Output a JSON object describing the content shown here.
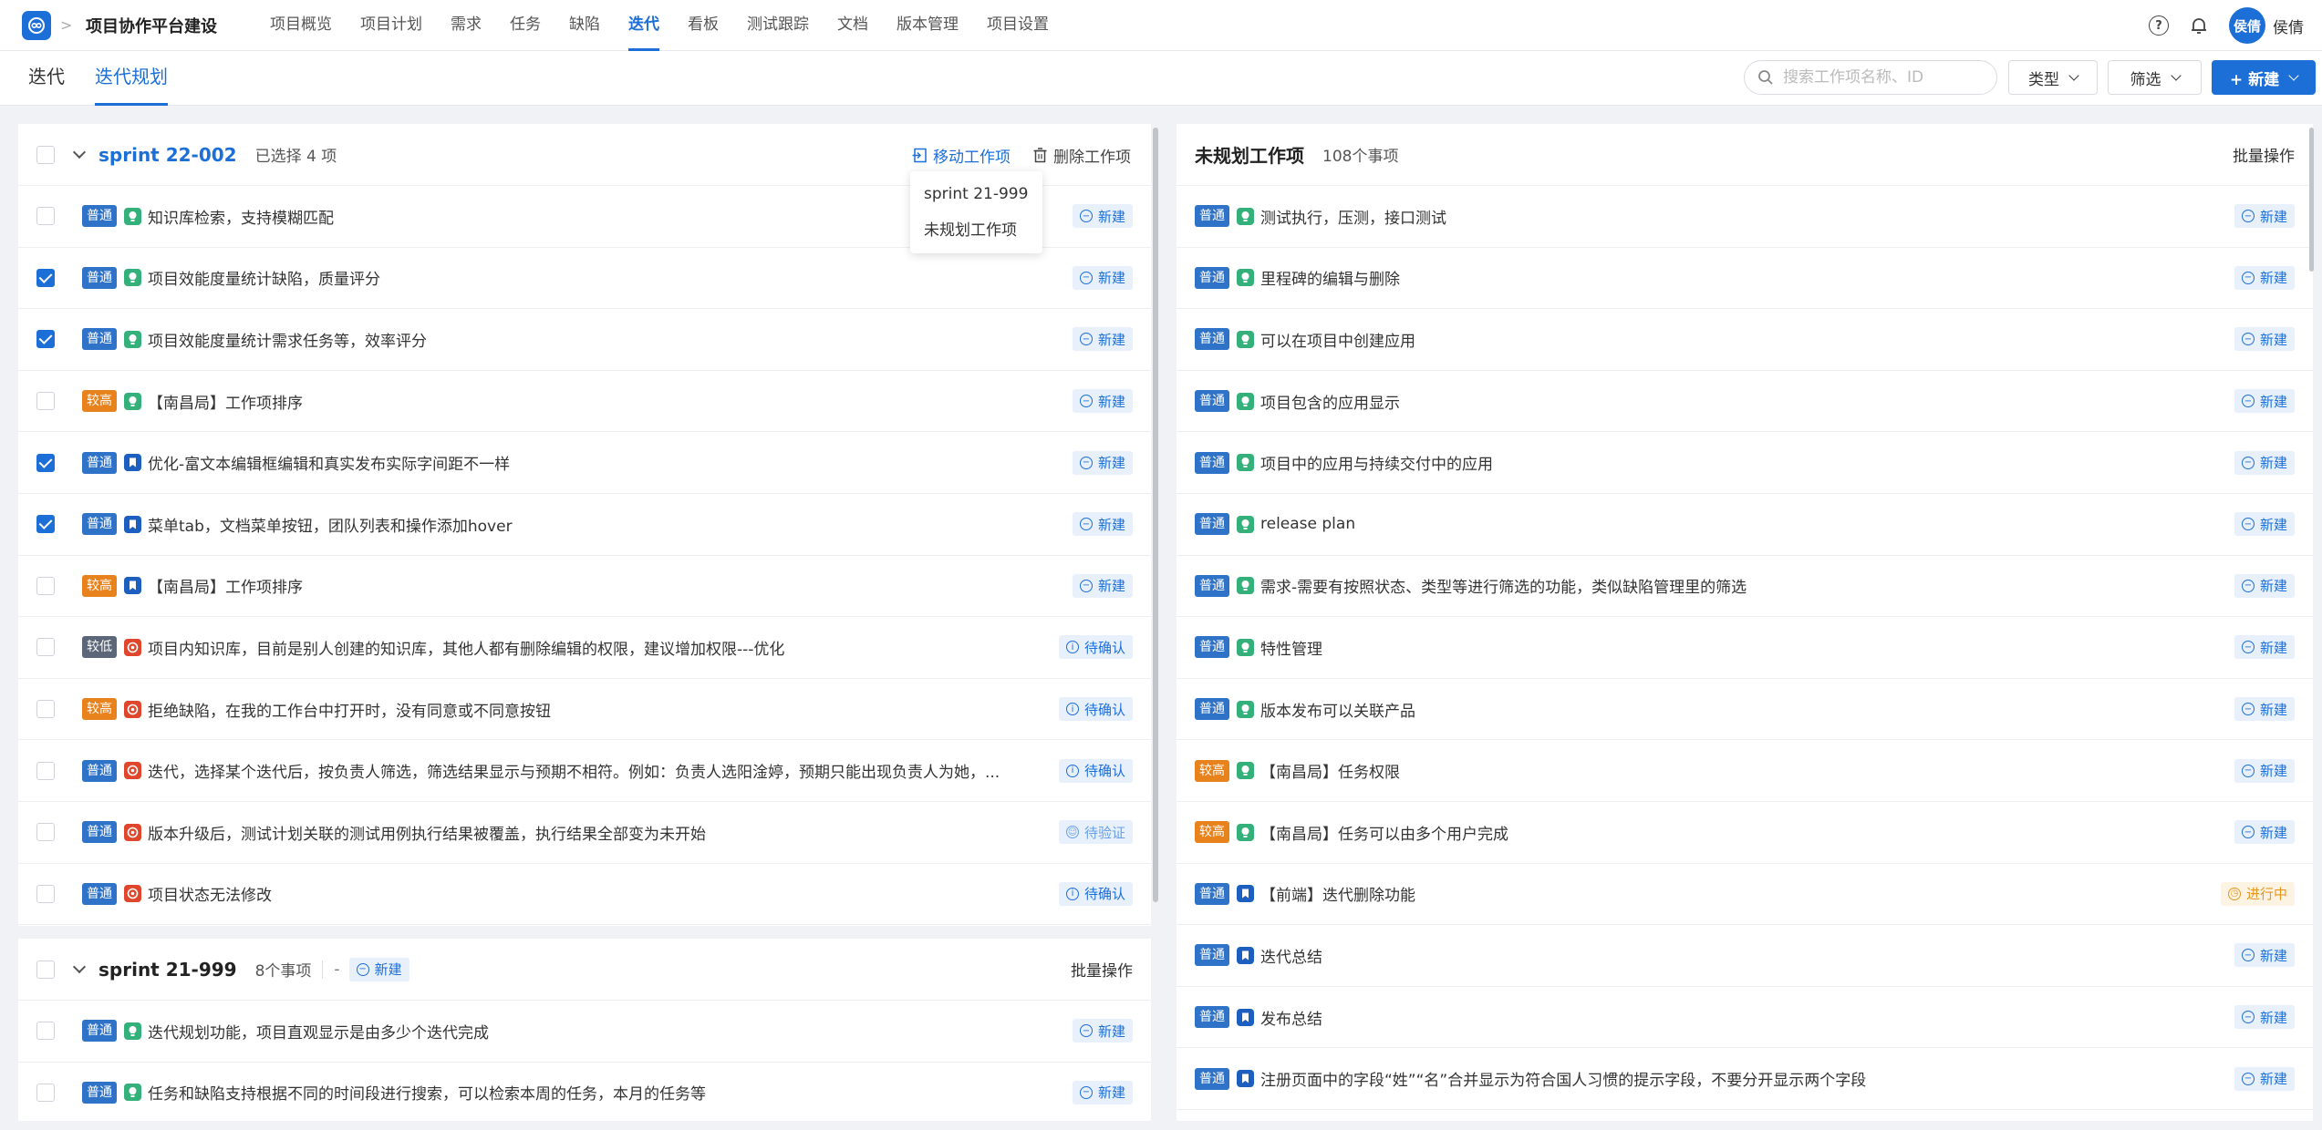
{
  "header": {
    "project_name": "项目协作平台建设",
    "nav": [
      "项目概览",
      "项目计划",
      "需求",
      "任务",
      "缺陷",
      "迭代",
      "看板",
      "测试跟踪",
      "文档",
      "版本管理",
      "项目设置"
    ],
    "active_nav": "迭代",
    "avatar_text": "侯倩",
    "user_name": "侯倩",
    "help_icon": "?"
  },
  "subbar": {
    "tabs": [
      "迭代",
      "迭代规划"
    ],
    "active_tab": "迭代规划",
    "search_placeholder": "搜索工作项名称、ID",
    "type_label": "类型",
    "filter_label": "筛选",
    "new_label": "+ 新建"
  },
  "colors": {
    "primary": "#1d6fd8",
    "prio_normal": "#2f73c9",
    "prio_high": "#e8821d",
    "prio_low": "#5b6778",
    "req_icon": "#34b07a",
    "task_icon": "#1d5fc0",
    "bug_icon": "#e0462c"
  },
  "sprint_a": {
    "title": "sprint 22-002",
    "selected": "已选择 4 项",
    "move_label": "移动工作项",
    "delete_label": "删除工作项",
    "menu": [
      "sprint 21-999",
      "未规划工作项"
    ],
    "rows": [
      {
        "checked": false,
        "prio": "普通",
        "ptype": "normal",
        "itype": "req",
        "title": "知识库检索，支持模糊匹配",
        "status": "新建",
        "stype": "new"
      },
      {
        "checked": true,
        "prio": "普通",
        "ptype": "normal",
        "itype": "req",
        "title": "项目效能度量统计缺陷，质量评分",
        "status": "新建",
        "stype": "new"
      },
      {
        "checked": true,
        "prio": "普通",
        "ptype": "normal",
        "itype": "req",
        "title": "项目效能度量统计需求任务等，效率评分",
        "status": "新建",
        "stype": "new"
      },
      {
        "checked": false,
        "prio": "较高",
        "ptype": "high",
        "itype": "req",
        "title": "【南昌局】工作项排序",
        "status": "新建",
        "stype": "new"
      },
      {
        "checked": true,
        "prio": "普通",
        "ptype": "normal",
        "itype": "task",
        "title": "优化-富文本编辑框编辑和真实发布实际字间距不一样",
        "status": "新建",
        "stype": "new"
      },
      {
        "checked": true,
        "prio": "普通",
        "ptype": "normal",
        "itype": "task",
        "title": "菜单tab，文档菜单按钮，团队列表和操作添加hover",
        "status": "新建",
        "stype": "new"
      },
      {
        "checked": false,
        "prio": "较高",
        "ptype": "high",
        "itype": "task",
        "title": "【南昌局】工作项排序",
        "status": "新建",
        "stype": "new"
      },
      {
        "checked": false,
        "prio": "较低",
        "ptype": "low",
        "itype": "bug",
        "title": "项目内知识库，目前是别人创建的知识库，其他人都有删除编辑的权限，建议增加权限---优化",
        "status": "待确认",
        "stype": "confirm"
      },
      {
        "checked": false,
        "prio": "较高",
        "ptype": "high",
        "itype": "bug",
        "title": "拒绝缺陷，在我的工作台中打开时，没有同意或不同意按钮",
        "status": "待确认",
        "stype": "confirm"
      },
      {
        "checked": false,
        "prio": "普通",
        "ptype": "normal",
        "itype": "bug",
        "title": "迭代，选择某个迭代后，按负责人筛选，筛选结果显示与预期不相符。例如：负责人选阳淦婷，预期只能出现负责人为她，...",
        "status": "待确认",
        "stype": "confirm"
      },
      {
        "checked": false,
        "prio": "普通",
        "ptype": "normal",
        "itype": "bug",
        "title": "版本升级后，测试计划关联的测试用例执行结果被覆盖，执行结果全部变为未开始",
        "status": "待验证",
        "stype": "verify"
      },
      {
        "checked": false,
        "prio": "普通",
        "ptype": "normal",
        "itype": "bug",
        "title": "项目状态无法修改",
        "status": "待确认",
        "stype": "confirm"
      }
    ]
  },
  "sprint_b": {
    "title": "sprint 21-999",
    "count": "8个事项",
    "dash": "-",
    "state": "新建",
    "batch": "批量操作",
    "rows": [
      {
        "checked": false,
        "prio": "普通",
        "ptype": "normal",
        "itype": "req",
        "title": "迭代规划功能，项目直观显示是由多少个迭代完成",
        "status": "新建",
        "stype": "new"
      },
      {
        "checked": false,
        "prio": "普通",
        "ptype": "normal",
        "itype": "req",
        "title": "任务和缺陷支持根据不同的时间段进行搜索，可以检索本周的任务，本月的任务等",
        "status": "新建",
        "stype": "new"
      }
    ]
  },
  "unplanned": {
    "title": "未规划工作项",
    "count": "108个事项",
    "batch": "批量操作",
    "rows": [
      {
        "prio": "普通",
        "ptype": "normal",
        "itype": "req",
        "title": "测试执行，压测，接口测试",
        "status": "新建",
        "stype": "new"
      },
      {
        "prio": "普通",
        "ptype": "normal",
        "itype": "req",
        "title": "里程碑的编辑与删除",
        "status": "新建",
        "stype": "new"
      },
      {
        "prio": "普通",
        "ptype": "normal",
        "itype": "req",
        "title": "可以在项目中创建应用",
        "status": "新建",
        "stype": "new"
      },
      {
        "prio": "普通",
        "ptype": "normal",
        "itype": "req",
        "title": "项目包含的应用显示",
        "status": "新建",
        "stype": "new"
      },
      {
        "prio": "普通",
        "ptype": "normal",
        "itype": "req",
        "title": "项目中的应用与持续交付中的应用",
        "status": "新建",
        "stype": "new"
      },
      {
        "prio": "普通",
        "ptype": "normal",
        "itype": "req",
        "title": "release plan",
        "status": "新建",
        "stype": "new"
      },
      {
        "prio": "普通",
        "ptype": "normal",
        "itype": "req",
        "title": "需求-需要有按照状态、类型等进行筛选的功能，类似缺陷管理里的筛选",
        "status": "新建",
        "stype": "new"
      },
      {
        "prio": "普通",
        "ptype": "normal",
        "itype": "req",
        "title": "特性管理",
        "status": "新建",
        "stype": "new"
      },
      {
        "prio": "普通",
        "ptype": "normal",
        "itype": "req",
        "title": "版本发布可以关联产品",
        "status": "新建",
        "stype": "new"
      },
      {
        "prio": "较高",
        "ptype": "high",
        "itype": "req",
        "title": "【南昌局】任务权限",
        "status": "新建",
        "stype": "new"
      },
      {
        "prio": "较高",
        "ptype": "high",
        "itype": "req",
        "title": "【南昌局】任务可以由多个用户完成",
        "status": "新建",
        "stype": "new"
      },
      {
        "prio": "普通",
        "ptype": "normal",
        "itype": "task",
        "title": "【前端】迭代删除功能",
        "status": "进行中",
        "stype": "progress"
      },
      {
        "prio": "普通",
        "ptype": "normal",
        "itype": "task",
        "title": "迭代总结",
        "status": "新建",
        "stype": "new"
      },
      {
        "prio": "普通",
        "ptype": "normal",
        "itype": "task",
        "title": "发布总结",
        "status": "新建",
        "stype": "new"
      },
      {
        "prio": "普通",
        "ptype": "normal",
        "itype": "task",
        "title": "注册页面中的字段“姓”“名”合并显示为符合国人习惯的提示字段，不要分开显示两个字段",
        "status": "新建",
        "stype": "new"
      }
    ]
  }
}
